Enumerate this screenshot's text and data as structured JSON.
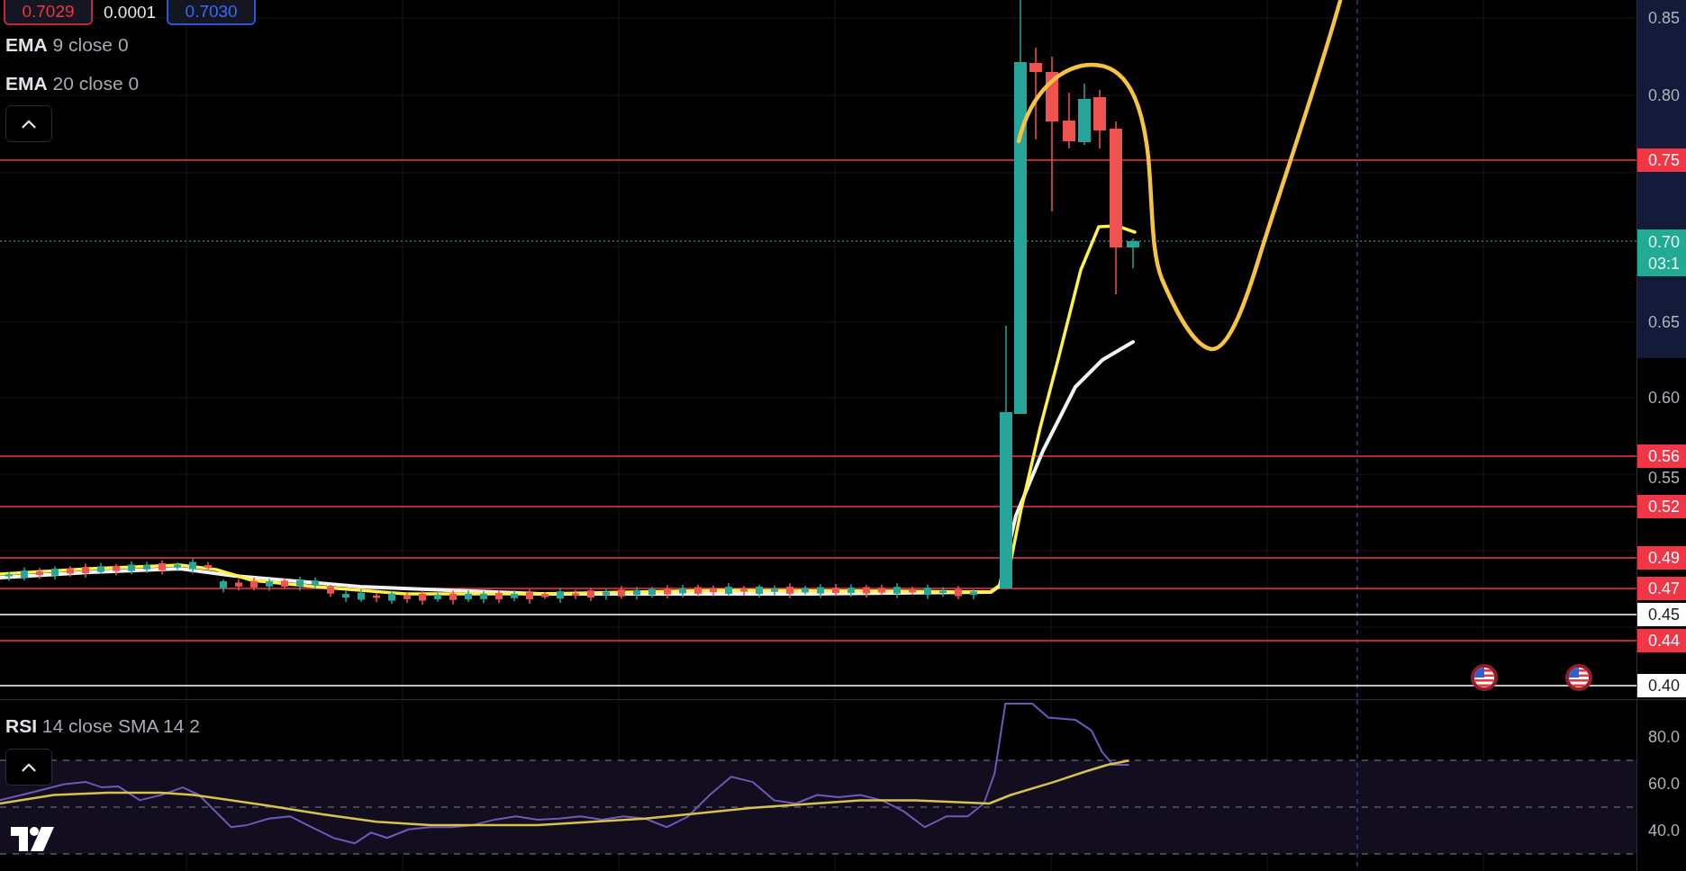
{
  "trade_panel": {
    "sell_price": "0.7029",
    "spread": "0.0001",
    "buy_price": "0.7030"
  },
  "legend": {
    "indicators": [
      {
        "title": "**EMA** 9 close 0"
      },
      {
        "title": "**EMA** 20 close 0"
      }
    ]
  },
  "price_axis": {
    "ticks": [
      "0.85",
      "0.80",
      "0.65",
      "0.60",
      "0.55"
    ]
  },
  "price_lines": [
    {
      "label": "0.75",
      "color": "#f23645"
    },
    {
      "label": "0.56",
      "color": "#f23645"
    },
    {
      "label": "0.52",
      "color": "#f23645"
    },
    {
      "label": "0.49",
      "color": "#f23645"
    },
    {
      "label": "0.47",
      "color": "#f23645"
    },
    {
      "label": "0.45",
      "color": "#ffffff"
    },
    {
      "label": "0.44",
      "color": "#f23645"
    },
    {
      "label": "0.40",
      "color": "#ffffff"
    }
  ],
  "current_price": {
    "price": "0.70",
    "countdown": "03:1"
  },
  "rsi_pane": {
    "title": "**RSI** 14 close SMA 14 2",
    "ticks": [
      "80.0",
      "60.0",
      "40.0"
    ]
  }
}
